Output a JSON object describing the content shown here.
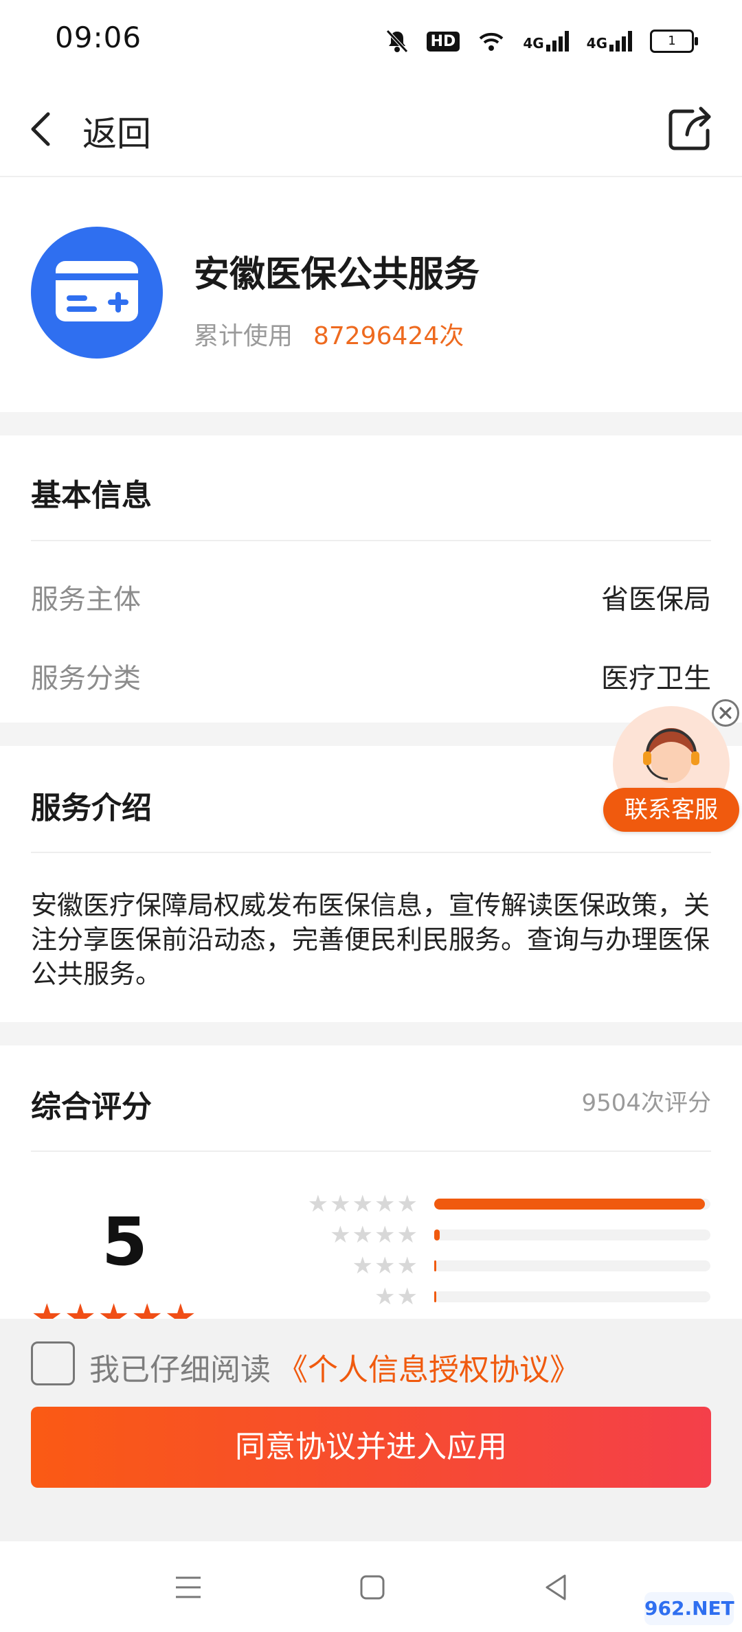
{
  "status_bar": {
    "time": "09:06",
    "hd_badge": "HD",
    "network_1": "4G",
    "network_2": "4G",
    "battery": "1"
  },
  "header": {
    "back_label": "返回"
  },
  "app": {
    "name": "安徽医保公共服务",
    "usage_label": "累计使用",
    "usage_value": "87296424次",
    "accent_color": "#ee6a1f",
    "icon_color": "#2f6ff0"
  },
  "basic_info": {
    "title": "基本信息",
    "rows": [
      {
        "label": "服务主体",
        "value": "省医保局"
      },
      {
        "label": "服务分类",
        "value": "医疗卫生"
      }
    ]
  },
  "intro": {
    "title": "服务介绍",
    "text": "安徽医疗保障局权威发布医保信息，宣传解读医保政策，关注分享医保前沿动态，完善便民利民服务。查询与办理医保公共服务。"
  },
  "rating": {
    "title": "综合评分",
    "count": "9504次评分",
    "score": "5",
    "score_stars": "★★★★★",
    "distribution": [
      {
        "stars": "★★★★★",
        "fraction": 0.98
      },
      {
        "stars": "★★★★",
        "fraction": 0.02
      },
      {
        "stars": "★★★",
        "fraction": 0.004
      },
      {
        "stars": "★★",
        "fraction": 0.004
      }
    ]
  },
  "customer_service": {
    "label": "联系客服"
  },
  "agreement": {
    "checkbox_text": "我已仔细阅读",
    "link_text": "《个人信息授权协议》",
    "button_label": "同意协议并进入应用"
  },
  "watermark": "962.NET"
}
